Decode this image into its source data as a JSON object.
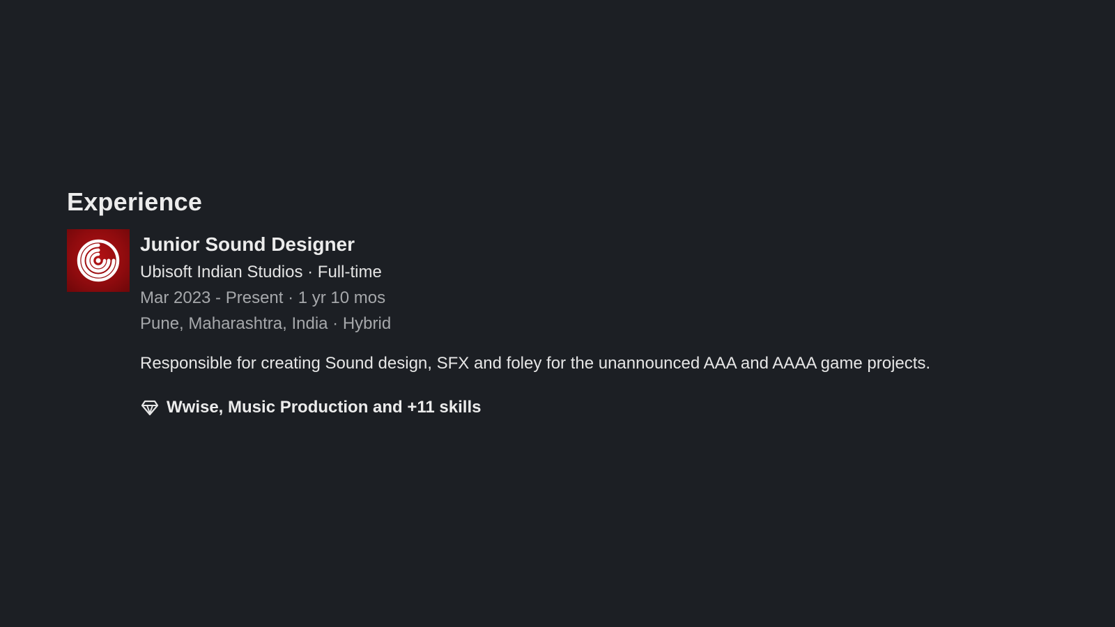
{
  "section": {
    "title": "Experience"
  },
  "experience": [
    {
      "logo_icon": "ubisoft-swirl-logo",
      "logo_color": "#a10f12",
      "title": "Junior Sound Designer",
      "company": "Ubisoft Indian Studios · Full-time",
      "duration": "Mar 2023 - Present · 1 yr 10 mos",
      "location": "Pune, Maharashtra, India · Hybrid",
      "description": "Responsible for creating Sound design, SFX and foley for the unannounced AAA and AAAA game projects.",
      "skills_icon": "diamond-icon",
      "skills": "Wwise, Music Production and +11 skills"
    }
  ]
}
